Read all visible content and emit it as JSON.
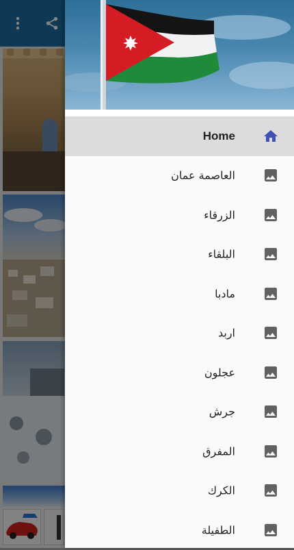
{
  "colors": {
    "toolbar": "#1a6ea4",
    "drawer_background": "#fafafa",
    "active_item_background": "#dcdcdc",
    "home_icon": "#3f51b5",
    "item_icon": "#616161",
    "text": "#212121"
  },
  "toolbar": {
    "icons": [
      "more-vert-icon",
      "share-icon"
    ]
  },
  "drawer": {
    "header_image": "jordan-flag-image",
    "items": [
      {
        "label": "Home",
        "icon": "home-icon",
        "active": true
      },
      {
        "label": "العاصمة عمان",
        "icon": "image-icon",
        "active": false
      },
      {
        "label": "الزرقاء",
        "icon": "image-icon",
        "active": false
      },
      {
        "label": "البلقاء",
        "icon": "image-icon",
        "active": false
      },
      {
        "label": "مادبا",
        "icon": "image-icon",
        "active": false
      },
      {
        "label": "اربد",
        "icon": "image-icon",
        "active": false
      },
      {
        "label": "عجلون",
        "icon": "image-icon",
        "active": false
      },
      {
        "label": "جرش",
        "icon": "image-icon",
        "active": false
      },
      {
        "label": "المفرق",
        "icon": "image-icon",
        "active": false
      },
      {
        "label": "الكرك",
        "icon": "image-icon",
        "active": false
      },
      {
        "label": "الطفيلة",
        "icon": "image-icon",
        "active": false
      }
    ]
  }
}
